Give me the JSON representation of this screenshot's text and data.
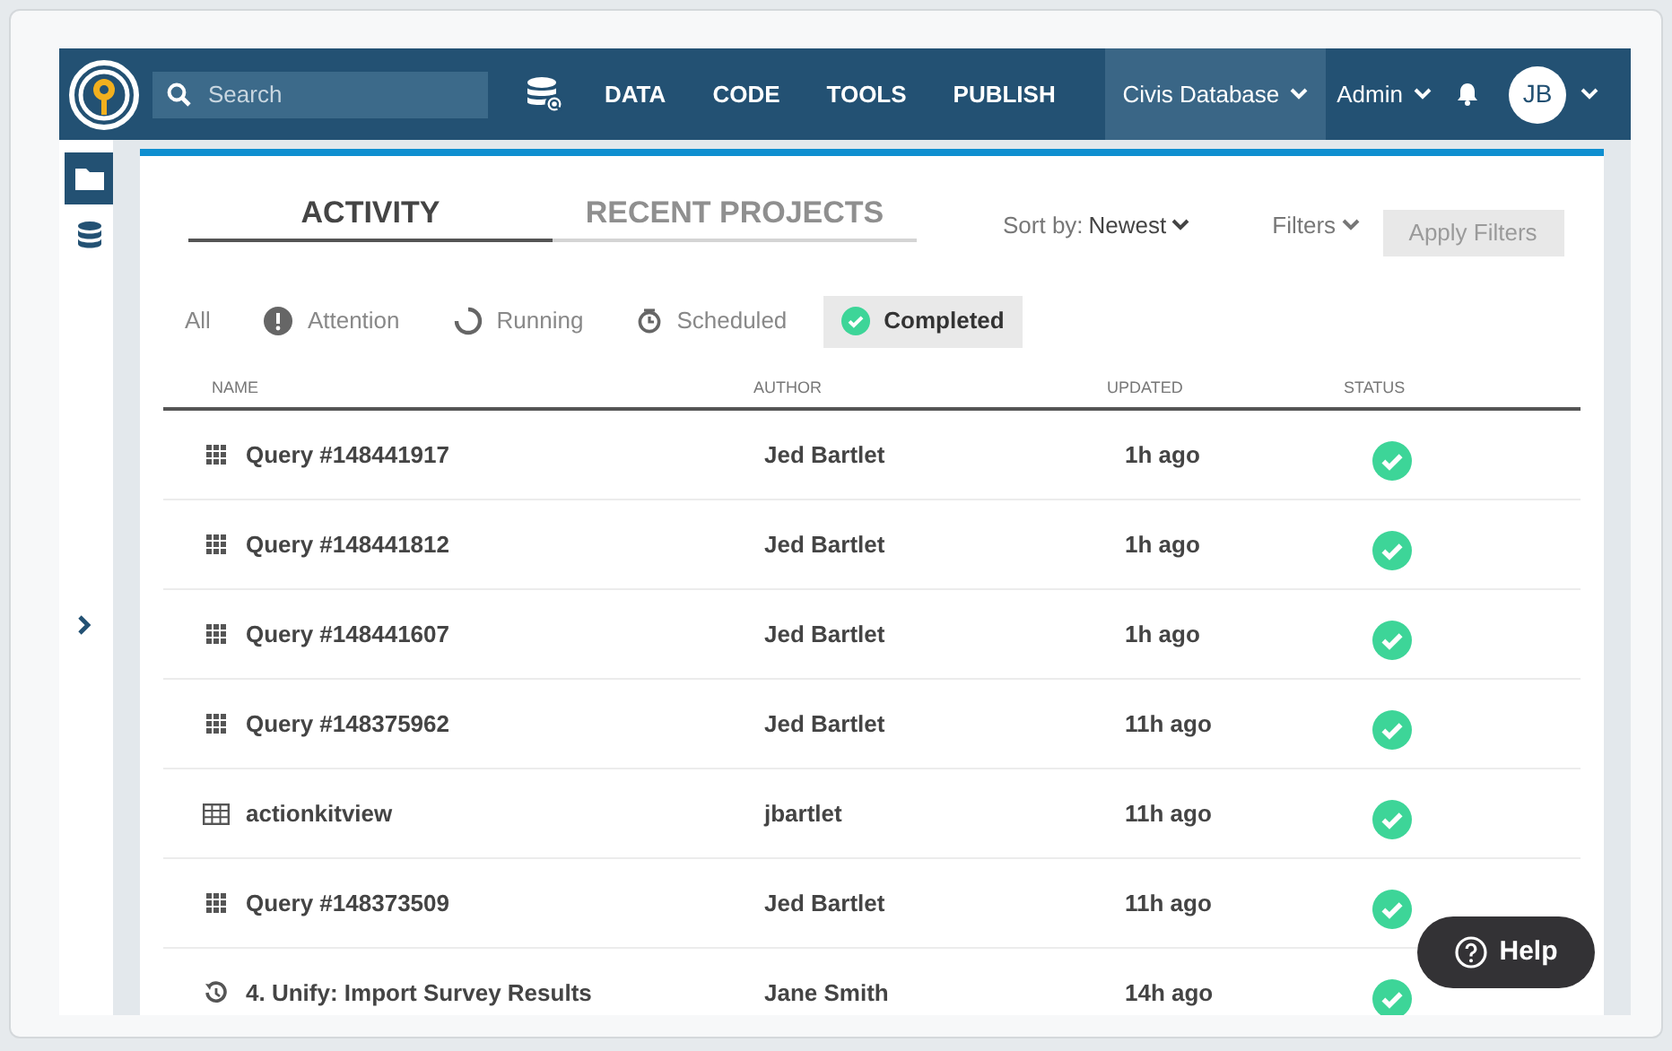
{
  "nav": {
    "search": {
      "placeholder": "Search"
    },
    "links": [
      "DATA",
      "CODE",
      "TOOLS",
      "PUBLISH"
    ],
    "database": {
      "label": "Civis Database",
      "selected": true
    },
    "admin": "Admin",
    "avatar": "JB"
  },
  "sidebar": {
    "items": [
      {
        "kind": "folder",
        "selected": true
      },
      {
        "kind": "database",
        "selected": false
      }
    ]
  },
  "tabs": [
    {
      "label": "ACTIVITY",
      "selected": true
    },
    {
      "label": "RECENT PROJECTS",
      "selected": false
    }
  ],
  "sort": {
    "label": "Sort by:",
    "value": "Newest"
  },
  "filters": "Filters",
  "apply_button": {
    "label": "Apply Filters",
    "disabled": true
  },
  "status_filters": [
    {
      "label": "All",
      "kind": "all",
      "selected": false
    },
    {
      "label": "Attention",
      "kind": "attention",
      "selected": false
    },
    {
      "label": "Running",
      "kind": "running",
      "selected": false
    },
    {
      "label": "Scheduled",
      "kind": "scheduled",
      "selected": false
    },
    {
      "label": "Completed",
      "kind": "completed",
      "selected": true
    }
  ],
  "table": {
    "columns": [
      "NAME",
      "AUTHOR",
      "UPDATED",
      "STATUS"
    ],
    "rows": [
      {
        "kind": "query",
        "name": "Query #148441917",
        "author": "Jed Bartlet",
        "updated": "1h ago",
        "completed": true
      },
      {
        "kind": "query",
        "name": "Query #148441812",
        "author": "Jed Bartlet",
        "updated": "1h ago",
        "completed": true
      },
      {
        "kind": "query",
        "name": "Query #148441607",
        "author": "Jed Bartlet",
        "updated": "1h ago",
        "completed": true
      },
      {
        "kind": "query",
        "name": "Query #148375962",
        "author": "Jed Bartlet",
        "updated": "11h ago",
        "completed": true
      },
      {
        "kind": "table",
        "name": "actionkitview",
        "author": "jbartlet",
        "updated": "11h ago",
        "completed": true
      },
      {
        "kind": "query",
        "name": "Query #148373509",
        "author": "Jed Bartlet",
        "updated": "11h ago",
        "completed": true
      },
      {
        "kind": "workflow",
        "name": "4. Unify: Import Survey Results",
        "author": "Jane Smith",
        "updated": "14h ago",
        "completed": true
      }
    ]
  },
  "help_button": "Help"
}
